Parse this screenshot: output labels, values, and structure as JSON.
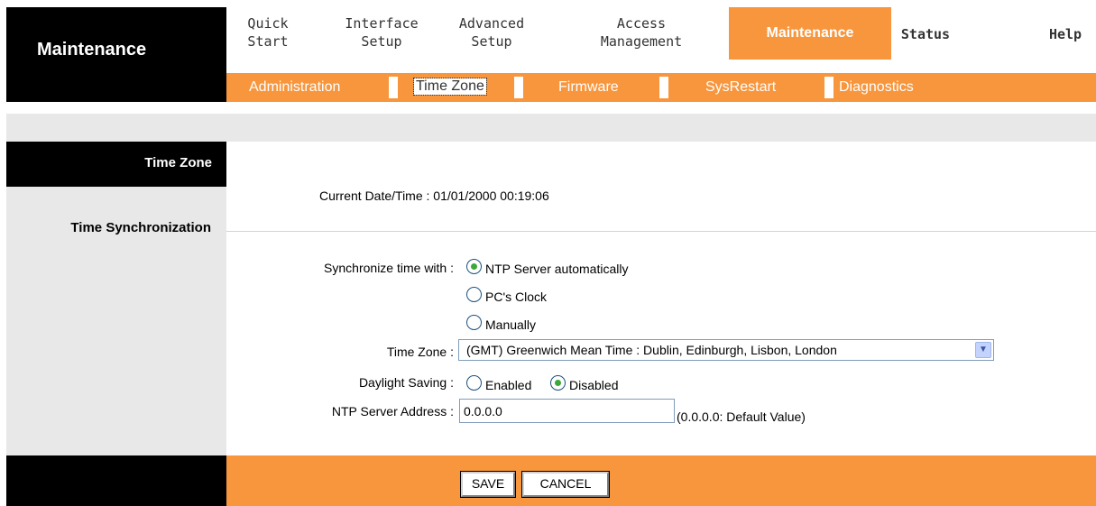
{
  "brand": {
    "title": "Maintenance"
  },
  "main_nav": [
    {
      "line1": "Quick",
      "line2": "Start"
    },
    {
      "line1": "Interface",
      "line2": "Setup"
    },
    {
      "line1": "Advanced",
      "line2": "Setup"
    },
    {
      "line1": "Access",
      "line2": "Management"
    },
    {
      "label": "Maintenance",
      "active": true
    },
    {
      "label": "Status"
    },
    {
      "label": "Help"
    }
  ],
  "sub_nav": [
    {
      "label": "Administration"
    },
    {
      "label": "Time Zone",
      "selected": true
    },
    {
      "label": "Firmware"
    },
    {
      "label": "SysRestart"
    },
    {
      "label": "Diagnostics"
    }
  ],
  "sidebar": {
    "section_title": "Time Zone",
    "section_label": "Time Synchronization"
  },
  "content": {
    "current_datetime_label": "Current Date/Time :",
    "current_datetime_value": "01/01/2000 00:19:06",
    "sync_label": "Synchronize time with :",
    "sync_options": [
      {
        "label": "NTP Server automatically",
        "checked": true
      },
      {
        "label": "PC's Clock",
        "checked": false
      },
      {
        "label": "Manually",
        "checked": false
      }
    ],
    "timezone_label": "Time Zone :",
    "timezone_value": "(GMT) Greenwich Mean Time : Dublin, Edinburgh, Lisbon, London",
    "dst_label": "Daylight Saving :",
    "dst_options": [
      {
        "label": "Enabled",
        "checked": false
      },
      {
        "label": "Disabled",
        "checked": true
      }
    ],
    "ntp_label": "NTP Server Address :",
    "ntp_value": "0.0.0.0",
    "ntp_hint": "(0.0.0.0: Default Value)"
  },
  "buttons": {
    "save": "SAVE",
    "cancel": "CANCEL"
  },
  "colors": {
    "accent": "#f7963d",
    "dark": "#000000",
    "panel": "#e8e8e8"
  }
}
